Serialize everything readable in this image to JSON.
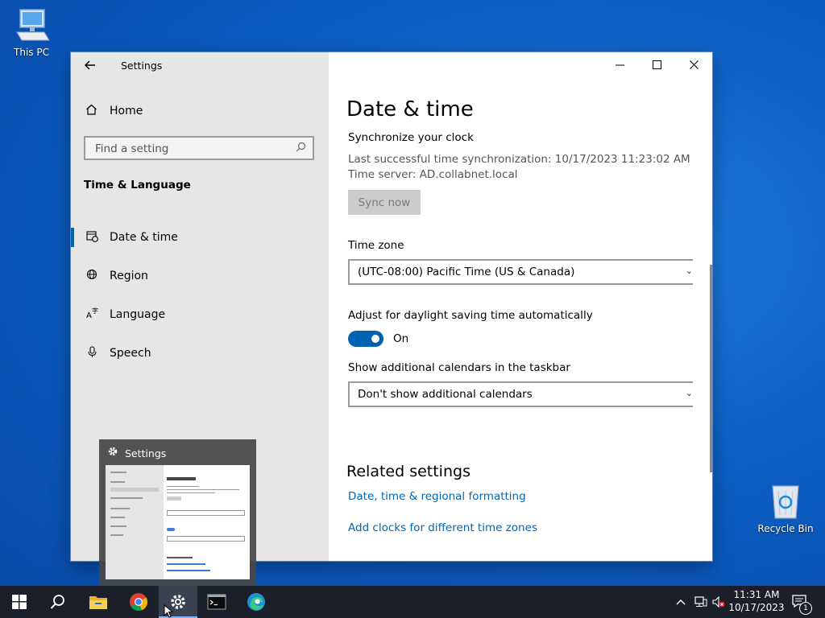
{
  "desktop": {
    "this_pc": "This PC",
    "recycle_bin": "Recycle Bin"
  },
  "window": {
    "app_title": "Settings",
    "sidebar": {
      "home": "Home",
      "search_placeholder": "Find a setting",
      "section": "Time & Language",
      "items": [
        {
          "label": "Date & time",
          "icon": "calendar-clock-icon",
          "selected": true
        },
        {
          "label": "Region",
          "icon": "globe-icon",
          "selected": false
        },
        {
          "label": "Language",
          "icon": "language-icon",
          "selected": false
        },
        {
          "label": "Speech",
          "icon": "microphone-icon",
          "selected": false
        }
      ]
    },
    "main": {
      "title": "Date & time",
      "sync_heading": "Synchronize your clock",
      "last_sync": "Last successful time synchronization: 10/17/2023 11:23:02 AM",
      "time_server": "Time server: AD.collabnet.local",
      "sync_button": "Sync now",
      "timezone_label": "Time zone",
      "timezone_value": "(UTC-08:00) Pacific Time (US & Canada)",
      "dst_label": "Adjust for daylight saving time automatically",
      "dst_state": "On",
      "calendars_label": "Show additional calendars in the taskbar",
      "calendars_value": "Don't show additional calendars",
      "related_title": "Related settings",
      "link_formatting": "Date, time & regional formatting",
      "link_clocks": "Add clocks for different time zones"
    }
  },
  "thumbnail": {
    "title": "Settings"
  },
  "taskbar": {
    "time": "11:31 AM",
    "date": "10/17/2023",
    "notification_count": "1"
  },
  "colors": {
    "accent": "#0063b1",
    "link": "#0066b4",
    "taskbar": "#1a1f2a"
  }
}
